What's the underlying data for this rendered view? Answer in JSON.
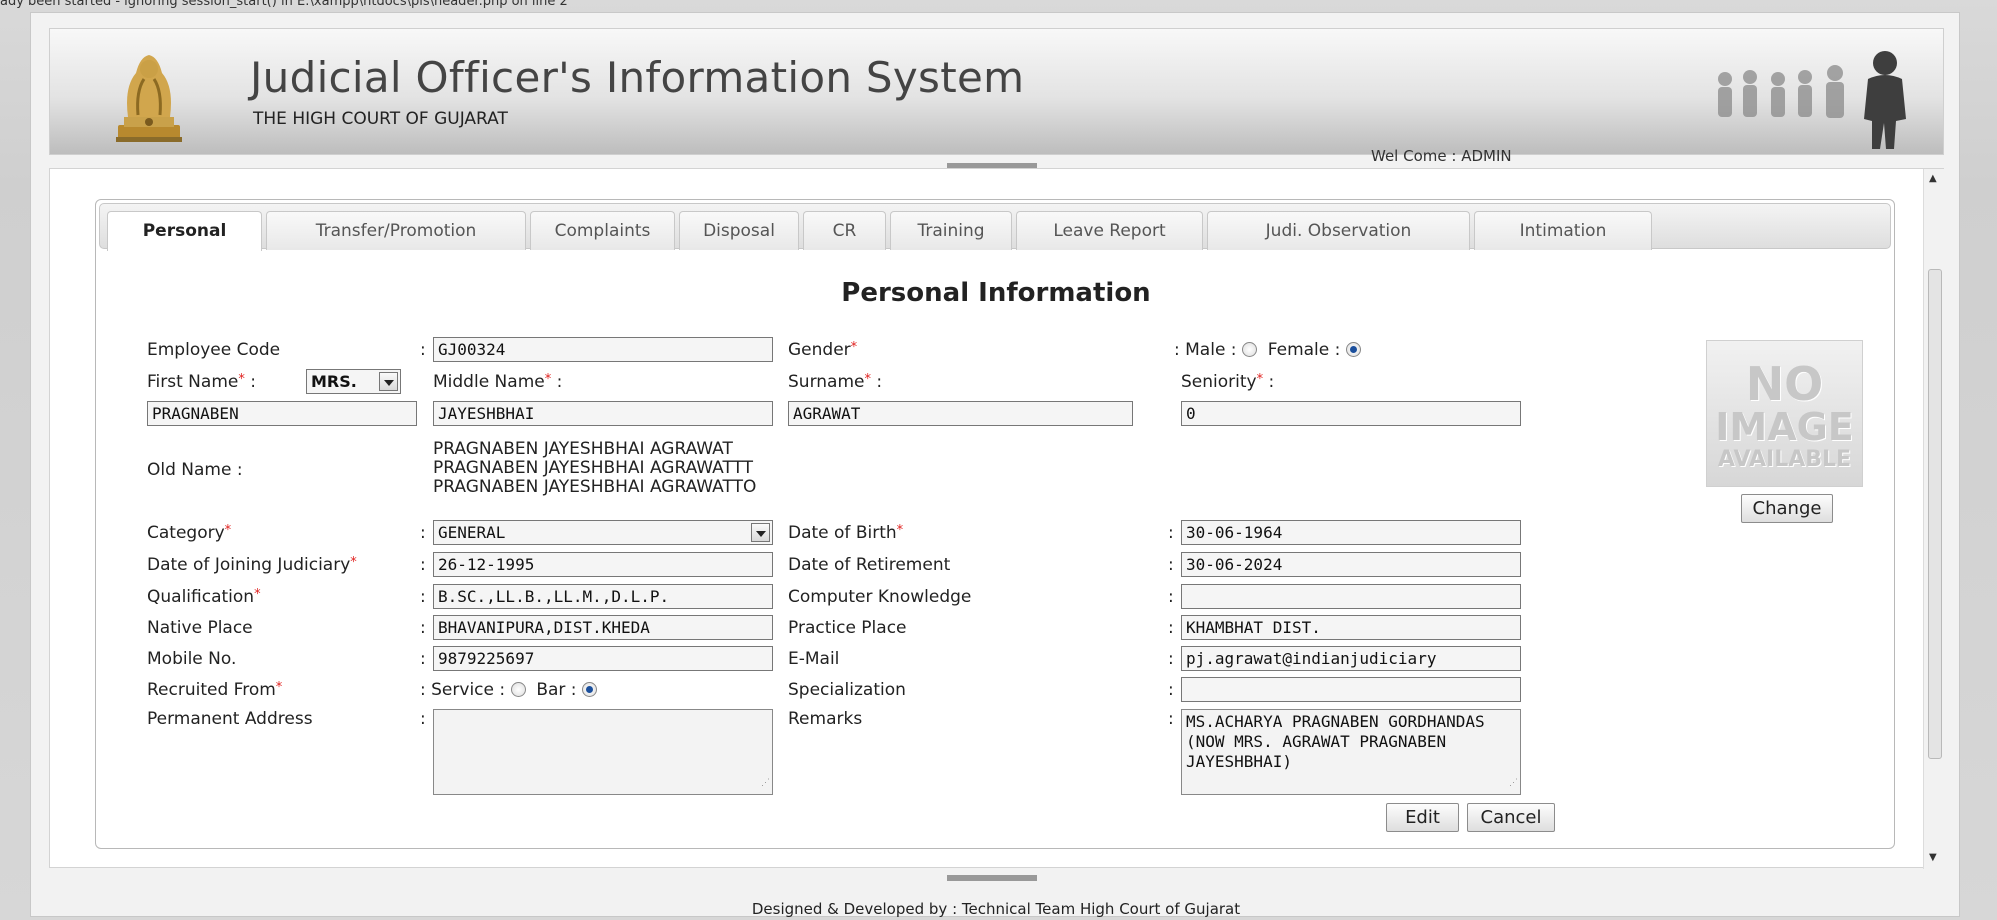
{
  "browser_warning": "ady been started - ignoring session_start() in E:\\xampp\\htdocs\\pis\\header.php on line 2",
  "header": {
    "title": "Judicial Officer's Information System",
    "subtitle": "THE HIGH COURT OF GUJARAT",
    "welcome": "Wel Come : ADMIN"
  },
  "tabs": [
    {
      "label": "Personal",
      "active": true
    },
    {
      "label": "Transfer/Promotion"
    },
    {
      "label": "Complaints"
    },
    {
      "label": "Disposal"
    },
    {
      "label": "CR"
    },
    {
      "label": "Training"
    },
    {
      "label": "Leave Report"
    },
    {
      "label": "Judi. Observation"
    },
    {
      "label": "Intimation"
    }
  ],
  "form": {
    "heading": "Personal Information",
    "employee_code_label": "Employee Code",
    "employee_code": "GJ00324",
    "gender_label": "Gender",
    "male_label": "Male :",
    "female_label": "Female :",
    "gender_value": "Female",
    "first_name_label": "First Name",
    "title_value": "MRS.",
    "middle_name_label": "Middle Name",
    "surname_label": "Surname",
    "seniority_label": "Seniority",
    "first_name": "PRAGNABEN",
    "middle_name": "JAYESHBHAI",
    "surname": "AGRAWAT",
    "seniority": "0",
    "old_name_label": "Old Name :",
    "old_names": [
      "PRAGNABEN JAYESHBHAI AGRAWAT",
      "PRAGNABEN JAYESHBHAI AGRAWATTT",
      "PRAGNABEN JAYESHBHAI AGRAWATTO"
    ],
    "category_label": "Category",
    "category": "GENERAL",
    "dob_label": "Date of Birth",
    "dob": "30-06-1964",
    "doj_label": "Date of Joining Judiciary",
    "doj": "26-12-1995",
    "dor_label": "Date of Retirement",
    "dor": "30-06-2024",
    "qualification_label": "Qualification",
    "qualification": "B.SC.,LL.B.,LL.M.,D.L.P.",
    "computer_knowledge_label": "Computer Knowledge",
    "computer_knowledge": "",
    "native_place_label": "Native Place",
    "native_place": "BHAVANIPURA,DIST.KHEDA",
    "practice_place_label": "Practice Place",
    "practice_place": "KHAMBHAT DIST.",
    "mobile_label": "Mobile No.",
    "mobile": "9879225697",
    "email_label": "E-Mail",
    "email": "pj.agrawat@indianjudiciary",
    "recruited_label": "Recruited From",
    "service_label": "Service :",
    "bar_label": "Bar :",
    "recruited_value": "Bar",
    "specialization_label": "Specialization",
    "specialization": "",
    "permanent_address_label": "Permanent Address",
    "permanent_address": "",
    "remarks_label": "Remarks",
    "remarks": "MS.ACHARYA PRAGNABEN GORDHANDAS (NOW MRS. AGRAWAT PRAGNABEN JAYESHBHAI)",
    "photo_text_1": "NO",
    "photo_text_2": "IMAGE",
    "photo_text_3": "AVAILABLE",
    "change_button": "Change",
    "edit_button": "Edit",
    "cancel_button": "Cancel"
  },
  "footer": "Designed & Developed by : Technical Team High Court of Gujarat"
}
